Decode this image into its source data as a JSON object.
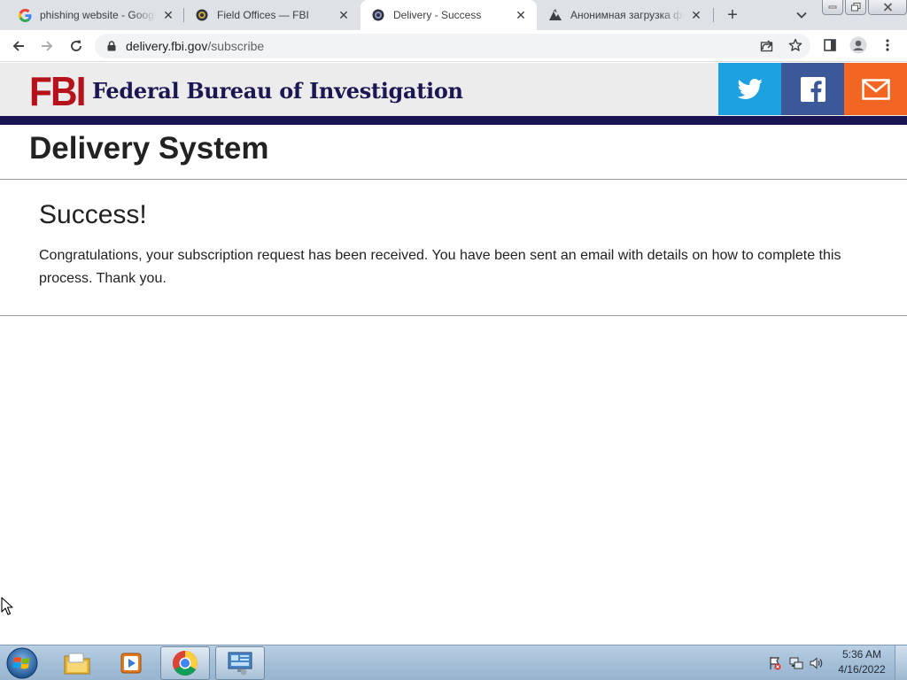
{
  "browser": {
    "tabs": [
      {
        "title": "phishing website - Google",
        "favicon": "google-g-icon",
        "active": false
      },
      {
        "title": "Field Offices — FBI",
        "favicon": "fbi-seal-icon",
        "active": false
      },
      {
        "title": "Delivery - Success",
        "favicon": "fbi-seal-icon",
        "active": true
      },
      {
        "title": "Анонимная загрузка фа",
        "favicon": "upload-site-icon",
        "active": false
      }
    ],
    "close_glyph": "✕",
    "new_tab_glyph": "+",
    "address": {
      "host": "delivery.fbi.gov",
      "path": "/subscribe"
    }
  },
  "site": {
    "logo_text": "FBI",
    "agency_name": "Federal Bureau of Investigation",
    "social": [
      {
        "name": "twitter",
        "color": "#1da1e0"
      },
      {
        "name": "facebook",
        "color": "#3b5998"
      },
      {
        "name": "email",
        "color": "#f26522"
      }
    ],
    "band_color": "#1a1452"
  },
  "page": {
    "title": "Delivery System",
    "heading": "Success!",
    "message": "Congratulations, your subscription request has been received. You have been sent an email with details on how to complete this process. Thank you."
  },
  "taskbar": {
    "pinned": [
      "windows-explorer-icon",
      "media-player-icon",
      "chrome-icon",
      "control-panel-icon"
    ],
    "clock": {
      "time": "5:36 AM",
      "date": "4/16/2022"
    }
  }
}
